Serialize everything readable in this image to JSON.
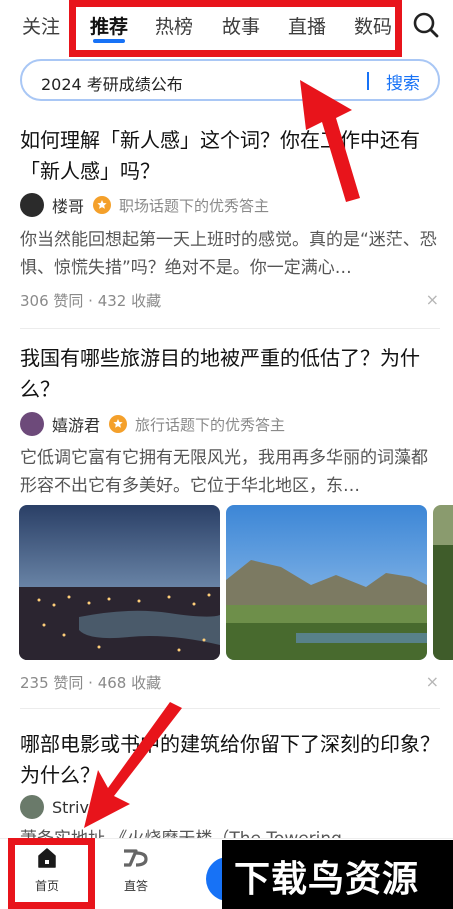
{
  "tabs": [
    "关注",
    "推荐",
    "热榜",
    "故事",
    "直播",
    "数码"
  ],
  "search": {
    "query": "2024 考研成绩公布",
    "button": "搜索"
  },
  "feed": [
    {
      "title": "如何理解「新人感」这个词？你在工作中还有「新人感」吗？",
      "author": "楼哥",
      "author_tag": "职场话题下的优秀答主",
      "excerpt": "你当然能回想起第一天上班时的感觉。真的是“迷茫、恐惧、惊慌失措”吗？绝对不是。你一定满心…",
      "stats": "306 赞同 · 432 收藏"
    },
    {
      "title": "我国有哪些旅游目的地被严重的低估了？为什么？",
      "author": "嬉游君",
      "author_tag": "旅行话题下的优秀答主",
      "excerpt": "它低调它富有它拥有无限风光，我用再多华丽的词藻都形容不出它有多美好。它位于华北地区，东…",
      "stats": "235 赞同 · 468 收藏"
    },
    {
      "title": "哪部电影或书中的建筑给你留下了深刻的印象？为什么？",
      "author": "Strive",
      "excerpt": "萧条实地址 《火烧摩天楼（The Towering"
    }
  ],
  "bottom_nav": {
    "home": "首页",
    "zhida": "直答"
  },
  "watermark": "下载鸟资源",
  "close_icon": "×",
  "colors": {
    "accent": "#1772f6",
    "annotation": "#e8141b",
    "badge": "#f4a02b"
  }
}
